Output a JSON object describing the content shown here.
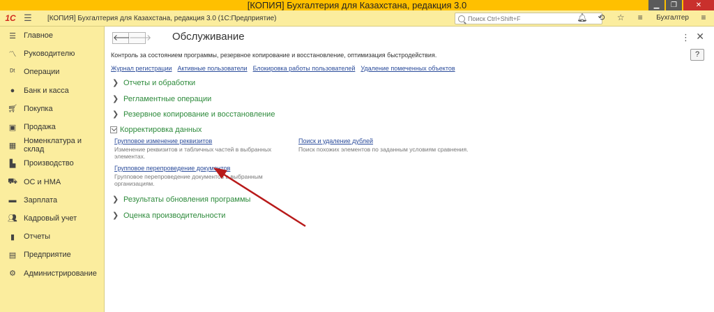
{
  "window": {
    "title": "[КОПИЯ] Бухгалтерия для Казахстана, редакция 3.0",
    "controls": [
      "minimize",
      "restore",
      "close"
    ]
  },
  "appbar": {
    "logo": "1С",
    "title": "[КОПИЯ] Бухгалтерия для Казахстана, редакция 3.0  (1С:Предприятие)",
    "search_placeholder": "Поиск Ctrl+Shift+F",
    "user": "Бухгалтер",
    "icons": [
      "bell-icon",
      "history-icon",
      "star-icon"
    ]
  },
  "sidebar": {
    "items": [
      {
        "label": "Главное",
        "icon": "menu-icon"
      },
      {
        "label": "Руководителю",
        "icon": "trend-icon"
      },
      {
        "label": "Операции",
        "icon": "operations-icon"
      },
      {
        "label": "Банк и касса",
        "icon": "bank-icon"
      },
      {
        "label": "Покупка",
        "icon": "cart-icon"
      },
      {
        "label": "Продажа",
        "icon": "bag-icon"
      },
      {
        "label": "Номенклатура и склад",
        "icon": "warehouse-icon"
      },
      {
        "label": "Производство",
        "icon": "factory-icon"
      },
      {
        "label": "ОС и НМА",
        "icon": "truck-icon"
      },
      {
        "label": "Зарплата",
        "icon": "money-icon"
      },
      {
        "label": "Кадровый учет",
        "icon": "people-icon"
      },
      {
        "label": "Отчеты",
        "icon": "reports-icon"
      },
      {
        "label": "Предприятие",
        "icon": "enterprise-icon"
      },
      {
        "label": "Администрирование",
        "icon": "gear-icon"
      }
    ]
  },
  "main": {
    "title": "Обслуживание",
    "description": "Контроль за состоянием программы, резервное копирование и восстановление, оптимизация быстродействия.",
    "links": [
      "Журнал регистрации",
      "Активные пользователи",
      "Блокировка работы пользователей",
      "Удаление помеченных объектов"
    ],
    "groups": {
      "reports": "Отчеты и обработки",
      "routine": "Регламентные операции",
      "backup": "Резервное копирование и восстановление",
      "correction": "Корректировка данных",
      "updates": "Результаты обновления программы",
      "performance": "Оценка производительности"
    },
    "correction_items": {
      "group_change": {
        "link": "Групповое изменение реквизитов",
        "desc_line1": "Изменение реквизитов и табличных частей в выбранных",
        "desc_line2": "элементах."
      },
      "dup_search": {
        "link": "Поиск и удаление дублей",
        "desc_line1": "Поиск похожих элементов по заданным условиям сравнения."
      },
      "group_repost": {
        "link": "Групповое перепроведение документов",
        "desc_line1": "Групповое перепроведение документов в выбранным",
        "desc_line2": "организациям."
      }
    },
    "help_label": "?"
  },
  "colors": {
    "title_bar": "#ffc000",
    "panel": "#fbed9e",
    "group_text": "#2d8a3b",
    "link": "#2b4c9b",
    "annotation_arrow": "#b81a1a"
  }
}
